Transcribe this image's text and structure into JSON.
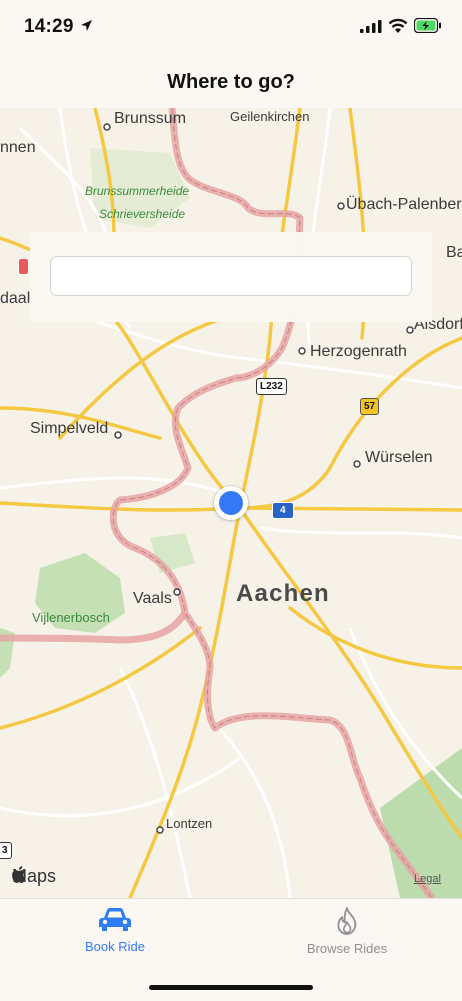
{
  "status_bar": {
    "time": "14:29",
    "icons": [
      "location-arrow-icon",
      "signal-icon",
      "wifi-icon",
      "battery-charging-icon"
    ],
    "battery_color": "#4cd964"
  },
  "nav": {
    "title": "Where to go?"
  },
  "search": {
    "value": "",
    "placeholder": ""
  },
  "map": {
    "labels": {
      "brunssum": "Brunssum",
      "geilenkirchen": "Geilenkirchen",
      "nnen": "nnen",
      "brunssummerheide": "Brunssummerheide",
      "schrieversheide": "Schrieversheide",
      "ubach": "Übach-Palenberg",
      "ba": "Ba",
      "daal": "daal",
      "alsdorf": "Alsdorf",
      "herzogenrath": "Herzogenrath",
      "simpelveld": "Simpelveld",
      "wurselen": "Würselen",
      "vaals": "Vaals",
      "aachen": "Aachen",
      "vijlenerbosch": "Vijlenerbosch",
      "lontzen": "Lontzen"
    },
    "shields": {
      "l232": "L232",
      "r57": "57",
      "a4": "4",
      "edge3": "3"
    },
    "attribution": "Maps",
    "legal": "Legal",
    "colors": {
      "border": "#e8a8a8",
      "road": "#f5c842",
      "green": "#b8d8a8",
      "background": "#f7f2e8"
    }
  },
  "tabs": [
    {
      "label": "Book Ride",
      "icon": "car-icon",
      "active": true
    },
    {
      "label": "Browse Rides",
      "icon": "flame-icon",
      "active": false
    }
  ],
  "accent": "#2f7cf6"
}
